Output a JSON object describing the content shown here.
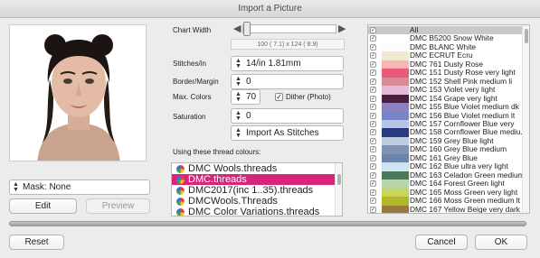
{
  "window": {
    "title": "Import a Picture"
  },
  "left": {
    "mask_label": "Mask: None",
    "edit_label": "Edit",
    "preview_label": "Preview"
  },
  "middle": {
    "chart_width_label": "Chart Width",
    "chart_width_info": "100 ( 7.1)  x 124 ( 8.9)",
    "chart_width_level": 0.04,
    "stitches_label": "Stitches/in",
    "stitches_value": "14/in 1.81mm",
    "border_label": "Border/Margin",
    "border_value": "0",
    "max_colors_label": "Max. Colors",
    "max_colors_value": "70",
    "dither_label": "Dither (Photo)",
    "saturation_label": "Saturation",
    "saturation_value": "0",
    "import_mode": "Import As Stitches",
    "threads_heading": "Using these thread colours:",
    "threads": [
      {
        "name": "DMC Wools.threads",
        "selected": false
      },
      {
        "name": "DMC.threads",
        "selected": true
      },
      {
        "name": "DMC2017(inc 1..35).threads",
        "selected": false
      },
      {
        "name": "DMCWools.Threads",
        "selected": false
      },
      {
        "name": "DMC Color Variations.threads",
        "selected": false
      }
    ]
  },
  "colors": [
    {
      "name": "All",
      "swatch": "",
      "all": true
    },
    {
      "name": "DMC B5200 Snow White",
      "swatch": "#ffffff"
    },
    {
      "name": "DMC BLANC White",
      "swatch": "#fcfcfc"
    },
    {
      "name": "DMC ECRUT Ecru",
      "swatch": "#f0e8cf"
    },
    {
      "name": "DMC  761 Dusty Rose",
      "swatch": "#f7b5b4"
    },
    {
      "name": "DMC  151 Dusty Rose very light",
      "swatch": "#e85a7a"
    },
    {
      "name": "DMC  152 Shell Pink medium li",
      "swatch": "#d98a92"
    },
    {
      "name": "DMC  153 Violet very light",
      "swatch": "#e6b8d8"
    },
    {
      "name": "DMC  154 Grape very light",
      "swatch": "#4a1e3a"
    },
    {
      "name": "DMC  155 Blue Violet medium dk",
      "swatch": "#8b80c0"
    },
    {
      "name": "DMC  156 Blue Violet medium lt",
      "swatch": "#7a84c8"
    },
    {
      "name": "DMC  157 Cornflower Blue very",
      "swatch": "#b6c4e8"
    },
    {
      "name": "DMC  158 Cornflower Blue mediu...",
      "swatch": "#2a3a80"
    },
    {
      "name": "DMC  159 Grey Blue light",
      "swatch": "#bccbe0"
    },
    {
      "name": "DMC  160 Grey Blue medium",
      "swatch": "#7f93b8"
    },
    {
      "name": "DMC  161 Grey Blue",
      "swatch": "#6c83aa"
    },
    {
      "name": "DMC  162 Blue ultra very light",
      "swatch": "#cfe4f2"
    },
    {
      "name": "DMC  163 Celadon Green medium",
      "swatch": "#4a7a58"
    },
    {
      "name": "DMC  164 Forest Green light",
      "swatch": "#b8d6a8"
    },
    {
      "name": "DMC  165 Moss Green very light",
      "swatch": "#c8d45a"
    },
    {
      "name": "DMC  166 Moss Green medium lt",
      "swatch": "#b0b82a"
    },
    {
      "name": "DMC  167 Yellow Beige very dark",
      "swatch": "#9a7a3a"
    }
  ],
  "footer": {
    "reset_label": "Reset",
    "cancel_label": "Cancel",
    "ok_label": "OK"
  }
}
